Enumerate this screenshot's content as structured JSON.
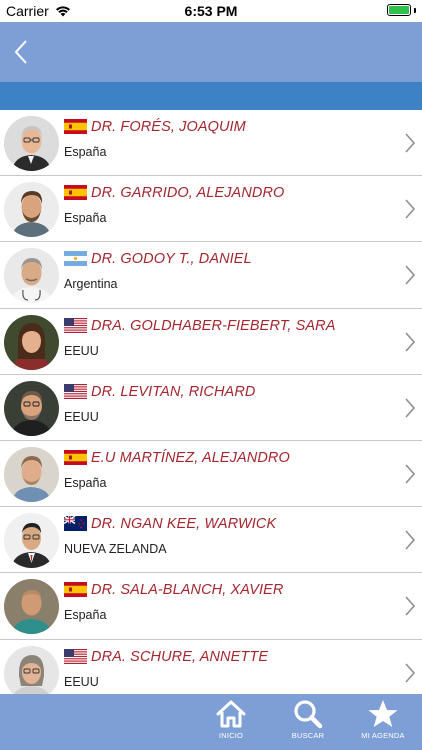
{
  "status_bar": {
    "carrier": "Carrier",
    "time": "6:53 PM"
  },
  "doctors": [
    {
      "name": "DR. FORÉS, JOAQUIM",
      "country": "España",
      "flag": "spain"
    },
    {
      "name": "DR. GARRIDO, ALEJANDRO",
      "country": "España",
      "flag": "spain"
    },
    {
      "name": "DR. GODOY T., DANIEL",
      "country": "Argentina",
      "flag": "argentina"
    },
    {
      "name": "DRA. GOLDHABER-FIEBERT, SARA",
      "country": "EEUU",
      "flag": "usa"
    },
    {
      "name": "DR. LEVITAN, RICHARD",
      "country": "EEUU",
      "flag": "usa"
    },
    {
      "name": "E.U MARTÍNEZ, ALEJANDRO",
      "country": "España",
      "flag": "spain"
    },
    {
      "name": "DR. NGAN KEE, WARWICK",
      "country": "NUEVA ZELANDA",
      "flag": "new-zealand"
    },
    {
      "name": "DR. SALA-BLANCH, XAVIER",
      "country": "España",
      "flag": "spain"
    },
    {
      "name": "DRA. SCHURE, ANNETTE",
      "country": "EEUU",
      "flag": "usa"
    }
  ],
  "tab_bar": {
    "home_label": "INICIO",
    "search_label": "BUSCAR",
    "agenda_label": "MI AGENDA"
  },
  "colors": {
    "nav_bar": "#7d9fd6",
    "sub_bar": "#3c82c4",
    "name_text": "#a3272f",
    "battery": "#2ec24a"
  }
}
